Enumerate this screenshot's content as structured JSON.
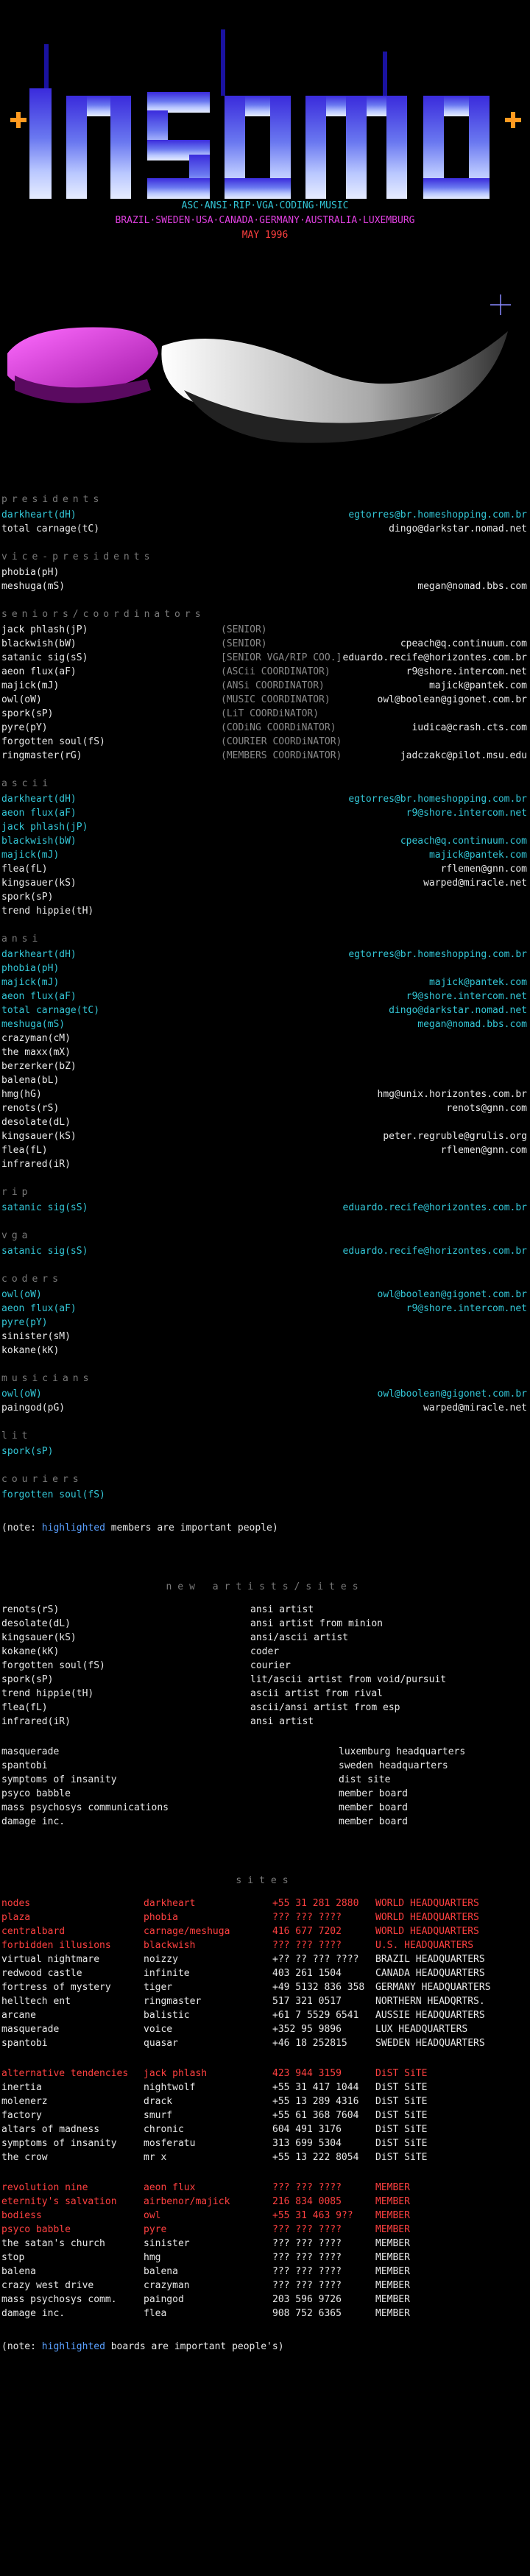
{
  "header": {
    "logo_text": "insomnia",
    "line1": "ASC·ANSI·RIP·VGA·CODING·MUSIC",
    "line2": "BRAZIL·SWEDEN·USA·CANADA·GERMANY·AUSTRALIA·LUXEMBURG",
    "line3": "MAY 1996",
    "colors": {
      "cyan": "#33c6d6",
      "hl": "#5aa0ff",
      "red": "#ff4040",
      "magenta": "#e040e0"
    }
  },
  "sections": [
    {
      "title": "presidents",
      "rows": [
        {
          "l": "darkheart(dH)",
          "r": "egtorres@br.homeshopping.com.br",
          "cls": "cyan"
        },
        {
          "l": "total carnage(tC)",
          "r": "dingo@darkstar.nomad.net",
          "cls": "white"
        }
      ]
    },
    {
      "title": "vice-presidents",
      "rows": [
        {
          "l": "phobia(pH)",
          "r": "",
          "cls": "white"
        },
        {
          "l": "meshuga(mS)",
          "r": "megan@nomad.bbs.com",
          "cls": "white"
        }
      ]
    },
    {
      "title": "seniors/coordinators",
      "rows": [
        {
          "l": "jack phlash(jP)",
          "c": "(SENIOR)",
          "r": "",
          "cls": "white"
        },
        {
          "l": "blackwish(bW)",
          "c": "(SENIOR)",
          "r": "cpeach@q.continuum.com",
          "cls": "white"
        },
        {
          "l": "satanic sig(sS)",
          "c": "[SENIOR VGA/RIP COO.]",
          "r": "eduardo.recife@horizontes.com.br",
          "cls": "white"
        },
        {
          "l": "aeon flux(aF)",
          "c": "(ASCii COORDINATOR)",
          "r": "r9@shore.intercom.net",
          "cls": "white"
        },
        {
          "l": "majick(mJ)",
          "c": "(ANSi COORDINATOR)",
          "r": "majick@pantek.com",
          "cls": "white"
        },
        {
          "l": "owl(oW)",
          "c": "(MUSIC COORDINATOR)",
          "r": "owl@boolean@gigonet.com.br",
          "cls": "white"
        },
        {
          "l": "spork(sP)",
          "c": "(LiT COORDiNATOR)",
          "r": "",
          "cls": "white"
        },
        {
          "l": "pyre(pY)",
          "c": "(CODiNG COORDiNATOR)",
          "r": "iudica@crash.cts.com",
          "cls": "white"
        },
        {
          "l": "forgotten soul(fS)",
          "c": "(COURIER COORDiNATOR)",
          "r": "",
          "cls": "white"
        },
        {
          "l": "ringmaster(rG)",
          "c": "(MEMBERS COORDiNATOR)",
          "r": "jadczakc@pilot.msu.edu",
          "cls": "white"
        }
      ]
    },
    {
      "title": "ascii",
      "rows": [
        {
          "l": "darkheart(dH)",
          "r": "egtorres@br.homeshopping.com.br",
          "cls": "cyan"
        },
        {
          "l": "aeon flux(aF)",
          "r": "r9@shore.intercom.net",
          "cls": "cyan"
        },
        {
          "l": "jack phlash(jP)",
          "r": "",
          "cls": "cyan"
        },
        {
          "l": "blackwish(bW)",
          "r": "cpeach@q.continuum.com",
          "cls": "cyan"
        },
        {
          "l": "majick(mJ)",
          "r": "majick@pantek.com",
          "cls": "cyan"
        },
        {
          "l": "flea(fL)",
          "r": "rflemen@gnn.com",
          "cls": "white"
        },
        {
          "l": "kingsauer(kS)",
          "r": "warped@miracle.net",
          "cls": "white"
        },
        {
          "l": "spork(sP)",
          "r": "",
          "cls": "white"
        },
        {
          "l": "trend hippie(tH)",
          "r": "",
          "cls": "white"
        }
      ]
    },
    {
      "title": "ansi",
      "rows": [
        {
          "l": "darkheart(dH)",
          "r": "egtorres@br.homeshopping.com.br",
          "cls": "cyan"
        },
        {
          "l": "phobia(pH)",
          "r": "",
          "cls": "cyan"
        },
        {
          "l": "majick(mJ)",
          "r": "majick@pantek.com",
          "cls": "cyan"
        },
        {
          "l": "aeon flux(aF)",
          "r": "r9@shore.intercom.net",
          "cls": "cyan"
        },
        {
          "l": "total carnage(tC)",
          "r": "dingo@darkstar.nomad.net",
          "cls": "cyan"
        },
        {
          "l": "meshuga(mS)",
          "r": "megan@nomad.bbs.com",
          "cls": "cyan"
        },
        {
          "l": "crazyman(cM)",
          "r": "",
          "cls": "white"
        },
        {
          "l": "the maxx(mX)",
          "r": "",
          "cls": "white"
        },
        {
          "l": "berzerker(bZ)",
          "r": "",
          "cls": "white"
        },
        {
          "l": "balena(bL)",
          "r": "",
          "cls": "white"
        },
        {
          "l": "hmg(hG)",
          "r": "hmg@unix.horizontes.com.br",
          "cls": "white"
        },
        {
          "l": "renots(rS)",
          "r": "renots@gnn.com",
          "cls": "white"
        },
        {
          "l": "desolate(dL)",
          "r": "",
          "cls": "white"
        },
        {
          "l": "kingsauer(kS)",
          "r": "peter.regruble@grulis.org",
          "cls": "white"
        },
        {
          "l": "flea(fL)",
          "r": "rflemen@gnn.com",
          "cls": "white"
        },
        {
          "l": "infrared(iR)",
          "r": "",
          "cls": "white"
        }
      ]
    },
    {
      "title": "rip",
      "rows": [
        {
          "l": "satanic sig(sS)",
          "r": "eduardo.recife@horizontes.com.br",
          "cls": "cyan"
        }
      ]
    },
    {
      "title": "vga",
      "rows": [
        {
          "l": "satanic sig(sS)",
          "r": "eduardo.recife@horizontes.com.br",
          "cls": "cyan"
        }
      ]
    },
    {
      "title": "coders",
      "rows": [
        {
          "l": "owl(oW)",
          "r": "owl@boolean@gigonet.com.br",
          "cls": "cyan"
        },
        {
          "l": "aeon flux(aF)",
          "r": "r9@shore.intercom.net",
          "cls": "cyan"
        },
        {
          "l": "pyre(pY)",
          "r": "",
          "cls": "cyan"
        },
        {
          "l": "sinister(sM)",
          "r": "",
          "cls": "white"
        },
        {
          "l": "kokane(kK)",
          "r": "",
          "cls": "white"
        }
      ]
    },
    {
      "title": "musicians",
      "rows": [
        {
          "l": "owl(oW)",
          "r": "owl@boolean@gigonet.com.br",
          "cls": "cyan"
        },
        {
          "l": "paingod(pG)",
          "r": "warped@miracle.net",
          "cls": "white"
        }
      ]
    },
    {
      "title": "lit",
      "rows": [
        {
          "l": "spork(sP)",
          "r": "",
          "cls": "cyan"
        }
      ]
    },
    {
      "title": "couriers",
      "rows": [
        {
          "l": "forgotten soul(fS)",
          "r": "",
          "cls": "cyan"
        }
      ]
    }
  ],
  "note1": {
    "pre": "(note: ",
    "hl": "highlighted",
    "mid": " members are ",
    "strong": "important people",
    "post": ")"
  },
  "new_artists": {
    "title": "new artists/sites",
    "rows": [
      {
        "l": "renots(rS)",
        "r": "ansi artist"
      },
      {
        "l": "desolate(dL)",
        "r": "ansi artist from minion"
      },
      {
        "l": "kingsauer(kS)",
        "r": "ansi/ascii artist"
      },
      {
        "l": "kokane(kK)",
        "r": "coder"
      },
      {
        "l": "forgotten soul(fS)",
        "r": "courier"
      },
      {
        "l": "spork(sP)",
        "r": "lit/ascii artist from void/pursuit"
      },
      {
        "l": "trend hippie(tH)",
        "r": "ascii artist from rival"
      },
      {
        "l": "flea(fL)",
        "r": "ascii/ansi artist from esp"
      },
      {
        "l": "infrared(iR)",
        "r": "ansi artist"
      }
    ],
    "rows2": [
      {
        "l": "masquerade",
        "r": "luxemburg headquarters"
      },
      {
        "l": "spantobi",
        "r": "sweden headquarters"
      },
      {
        "l": "symptoms of insanity",
        "r": "dist site"
      },
      {
        "l": "psyco babble",
        "r": "member board"
      },
      {
        "l": "mass psychosys communications",
        "r": "member board"
      },
      {
        "l": "damage inc.",
        "r": "member board"
      }
    ]
  },
  "sites": {
    "title": "sites",
    "groups": [
      [
        {
          "a": "nodes",
          "b": "darkheart",
          "n": "+55 31 281 2880",
          "s": "WORLD HEADQUARTERS",
          "cls": "red"
        },
        {
          "a": "plaza",
          "b": "phobia",
          "n": "??? ??? ????",
          "s": "WORLD HEADQUARTERS",
          "cls": "red"
        },
        {
          "a": "centralbard",
          "b": "carnage/meshuga",
          "n": "416 677 7202",
          "s": "WORLD HEADQUARTERS",
          "cls": "red"
        },
        {
          "a": "forbidden illusions",
          "b": "blackwish",
          "n": "??? ??? ????",
          "s": "U.S. HEADQUARTERS",
          "cls": "red"
        },
        {
          "a": "virtual nightmare",
          "b": "noizzy",
          "n": "+?? ?? ??? ????",
          "s": "BRAZIL HEADQUARTERS",
          "cls": "white"
        },
        {
          "a": "redwood castle",
          "b": "infinite",
          "n": "403 261 1504",
          "s": "CANADA HEADQUARTERS",
          "cls": "white"
        },
        {
          "a": "fortress of mystery",
          "b": "tiger",
          "n": "+49 5132 836 358",
          "s": "GERMANY HEADQUARTERS",
          "cls": "white"
        },
        {
          "a": "helltech ent",
          "b": "ringmaster",
          "n": "517 321 0517",
          "s": "NORTHERN HEADQRTRS.",
          "cls": "white"
        },
        {
          "a": "arcane",
          "b": "balistic",
          "n": "+61 7 5529 6541",
          "s": "AUSSIE HEADQUARTERS",
          "cls": "white"
        },
        {
          "a": "masquerade",
          "b": "voice",
          "n": "+352 95 9896",
          "s": "LUX HEADQUARTERS",
          "cls": "white"
        },
        {
          "a": "spantobi",
          "b": "quasar",
          "n": "+46 18 252815",
          "s": "SWEDEN HEADQUARTERS",
          "cls": "white"
        }
      ],
      [
        {
          "a": "alternative tendencies",
          "b": "jack phlash",
          "n": "423 944 3159",
          "s": "DiST SiTE",
          "cls": "red"
        },
        {
          "a": "inertia",
          "b": "nightwolf",
          "n": "+55 31 417 1044",
          "s": "DiST SiTE",
          "cls": "white"
        },
        {
          "a": "molenerz",
          "b": "drack",
          "n": "+55 13 289 4316",
          "s": "DiST SiTE",
          "cls": "white"
        },
        {
          "a": "factory",
          "b": "smurf",
          "n": "+55 61 368 7604",
          "s": "DiST SiTE",
          "cls": "white"
        },
        {
          "a": "altars of madness",
          "b": "chronic",
          "n": "604 491 3176",
          "s": "DiST SiTE",
          "cls": "white"
        },
        {
          "a": "symptoms of insanity",
          "b": "mosferatu",
          "n": "313 699 5304",
          "s": "DiST SiTE",
          "cls": "white"
        },
        {
          "a": "the crow",
          "b": "mr x",
          "n": "+55 13 222 8054",
          "s": "DiST SiTE",
          "cls": "white"
        }
      ],
      [
        {
          "a": "revolution nine",
          "b": "aeon flux",
          "n": "??? ??? ????",
          "s": "MEMBER",
          "cls": "red"
        },
        {
          "a": "eternity's salvation",
          "b": "airbenor/majick",
          "n": "216 834 0085",
          "s": "MEMBER",
          "cls": "red"
        },
        {
          "a": "bodiess",
          "b": "owl",
          "n": "+55 31 463 9??",
          "s": "MEMBER",
          "cls": "red"
        },
        {
          "a": "psyco babble",
          "b": "pyre",
          "n": "??? ??? ????",
          "s": "MEMBER",
          "cls": "red"
        },
        {
          "a": "the satan's church",
          "b": "sinister",
          "n": "??? ??? ????",
          "s": "MEMBER",
          "cls": "white"
        },
        {
          "a": "stop",
          "b": "hmg",
          "n": "??? ??? ????",
          "s": "MEMBER",
          "cls": "white"
        },
        {
          "a": "balena",
          "b": "balena",
          "n": "??? ??? ????",
          "s": "MEMBER",
          "cls": "white"
        },
        {
          "a": "crazy west drive",
          "b": "crazyman",
          "n": "??? ??? ????",
          "s": "MEMBER",
          "cls": "white"
        },
        {
          "a": "mass psychosys comm.",
          "b": "paingod",
          "n": "203 596 9726",
          "s": "MEMBER",
          "cls": "white"
        },
        {
          "a": "damage inc.",
          "b": "flea",
          "n": "908 752 6365",
          "s": "MEMBER",
          "cls": "white"
        }
      ]
    ]
  },
  "note2": {
    "pre": "(note: ",
    "hl": "highlighted",
    "mid": " boards are ",
    "strong": "important people's",
    "post": ")"
  }
}
